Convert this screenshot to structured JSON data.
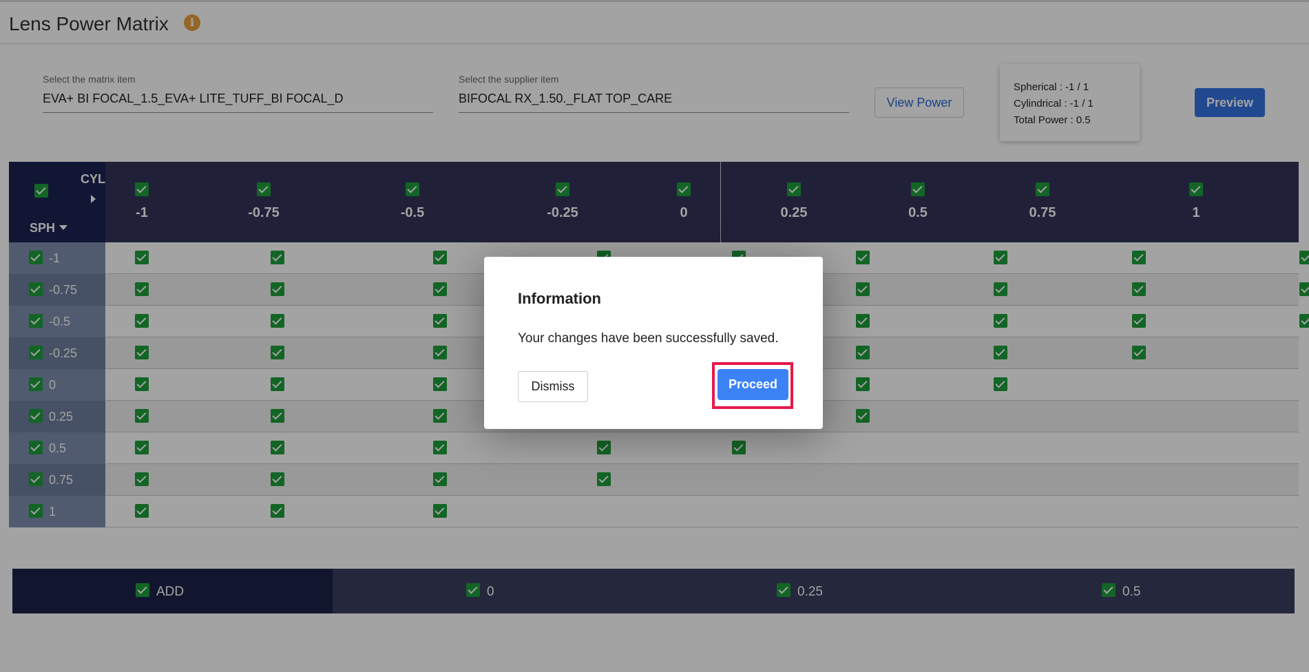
{
  "header": {
    "title": "Lens Power Matrix",
    "info_icon": "i"
  },
  "filters": {
    "matrix_label": "Select the matrix item",
    "matrix_value": "EVA+ BI FOCAL_1.5_EVA+ LITE_TUFF_BI FOCAL_D",
    "supplier_label": "Select the supplier item",
    "supplier_value": "BIFOCAL RX_1.50._FLAT TOP_CARE"
  },
  "actions": {
    "view_power": "View Power",
    "preview": "Preview"
  },
  "power_summary": {
    "spherical": "Spherical : -1 / 1",
    "cylindrical": "Cylindrical : -1 / 1",
    "total": "Total Power : 0.5"
  },
  "matrix": {
    "cyl_label": "CYL",
    "sph_label": "SPH",
    "columns": [
      "-1",
      "-0.75",
      "-0.5",
      "-0.25",
      "0",
      "0.25",
      "0.5",
      "0.75",
      "1"
    ],
    "rows": [
      {
        "label": "-1",
        "checked_columns": 9
      },
      {
        "label": "-0.75",
        "checked_columns": 9
      },
      {
        "label": "-0.5",
        "checked_columns": 9
      },
      {
        "label": "-0.25",
        "checked_columns": 8
      },
      {
        "label": "0",
        "checked_columns": 7
      },
      {
        "label": "0.25",
        "checked_columns": 6
      },
      {
        "label": "0.5",
        "checked_columns": 5
      },
      {
        "label": "0.75",
        "checked_columns": 4
      },
      {
        "label": "1",
        "checked_columns": 3
      }
    ]
  },
  "add_bar": {
    "label": "ADD",
    "values": [
      "0",
      "0.25",
      "0.5"
    ]
  },
  "dialog": {
    "title": "Information",
    "message": "Your changes have been successfully saved.",
    "dismiss": "Dismiss",
    "proceed": "Proceed"
  },
  "colors": {
    "header_bg": "#33345a",
    "corner_bg": "#1b2352",
    "check_green": "#1e9e3a",
    "primary": "#3b82f6",
    "highlight": "#e8174b"
  }
}
